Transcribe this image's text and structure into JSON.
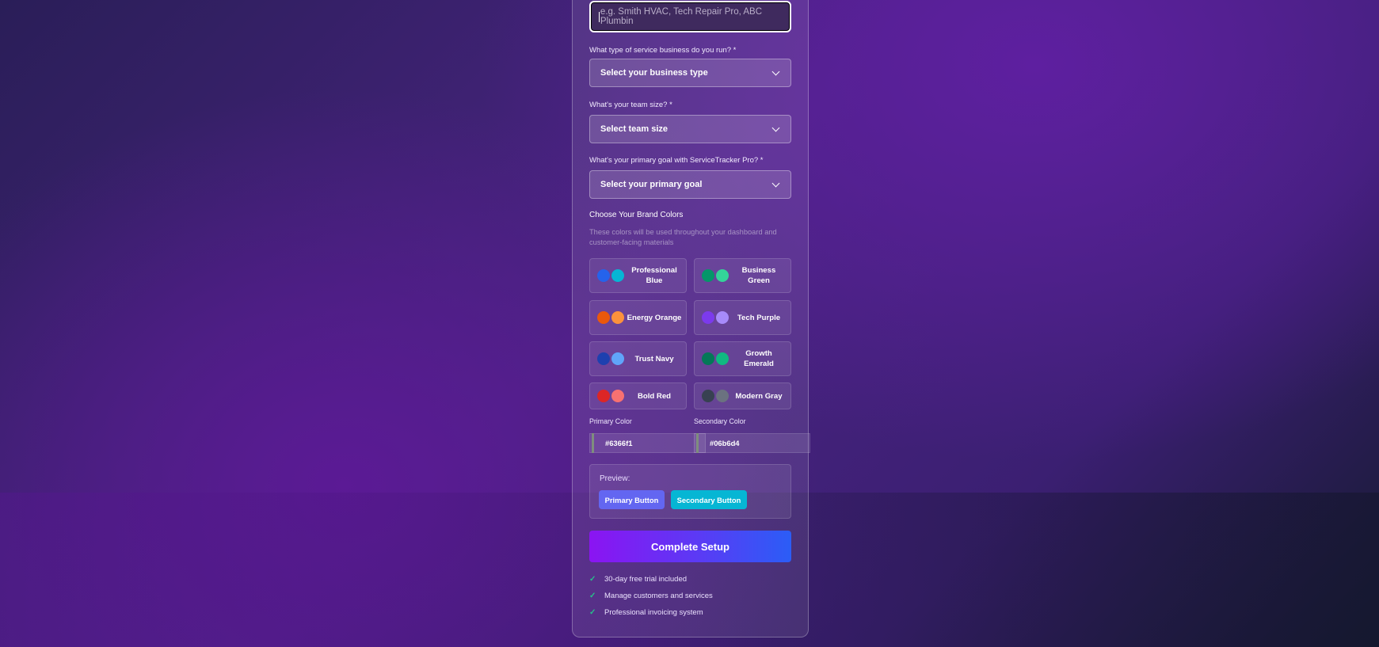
{
  "form": {
    "business_name_placeholder": "e.g. Smith HVAC, Tech Repair Pro, ABC Plumbin",
    "business_type_label": "What type of service business do you run? *",
    "business_type_value": "Select your business type",
    "team_size_label": "What's your team size? *",
    "team_size_value": "Select team size",
    "goal_label": "What's your primary goal with ServiceTracker Pro? *",
    "goal_value": "Select your primary goal"
  },
  "brand": {
    "title": "Choose Your Brand Colors",
    "help": "These colors will be used throughout your dashboard and customer-facing materials",
    "presets": [
      {
        "label": "Professional Blue",
        "primary": "#2563eb",
        "secondary": "#06b6d4"
      },
      {
        "label": "Business Green",
        "primary": "#059669",
        "secondary": "#34d399"
      },
      {
        "label": "Energy Orange",
        "primary": "#ea580c",
        "secondary": "#fb923c"
      },
      {
        "label": "Tech Purple",
        "primary": "#7c3aed",
        "secondary": "#a78bfa"
      },
      {
        "label": "Trust Navy",
        "primary": "#1e40af",
        "secondary": "#60a5fa"
      },
      {
        "label": "Growth Emerald",
        "primary": "#047857",
        "secondary": "#10b981"
      },
      {
        "label": "Bold Red",
        "primary": "#dc2626",
        "secondary": "#f87171"
      },
      {
        "label": "Modern Gray",
        "primary": "#374151",
        "secondary": "#6b7280"
      }
    ],
    "primary_label": "Primary Color",
    "secondary_label": "Secondary Color",
    "primary_value": "#6366f1",
    "secondary_value": "#06b6d4"
  },
  "preview": {
    "label": "Preview:",
    "primary_button": "Primary Button",
    "secondary_button": "Secondary Button"
  },
  "submit_label": "Complete Setup",
  "features": [
    "30-day free trial included",
    "Manage customers and services",
    "Professional invoicing system"
  ]
}
